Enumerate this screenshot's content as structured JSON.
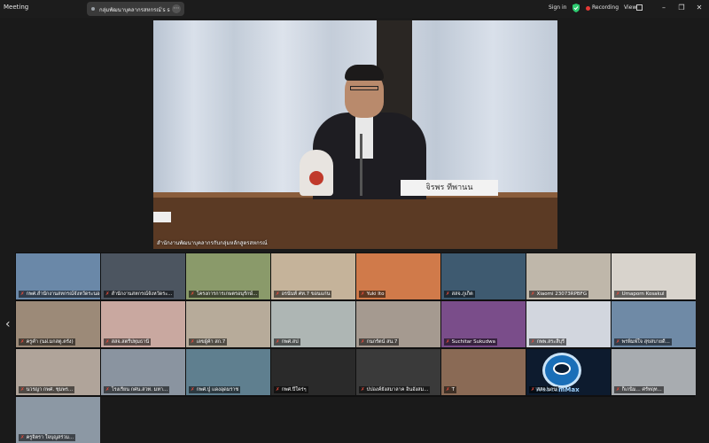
{
  "window": {
    "title": "Meeting",
    "share_text": "กลุ่มพัฒนาบุคลากรสหกรณ์'s screen"
  },
  "topbar": {
    "sign_in": "Sign in",
    "recording": "Recording",
    "view": "View"
  },
  "speaker": {
    "name": "สำนักงานพัฒนาบุคลากรกับกลุ่มหลักสูตรสหกรณ์",
    "nameplate": "จิรพร ทีพานน"
  },
  "colors": {
    "recording": "#e53935",
    "mute": "#e74c3c",
    "shield": "#2ecc71"
  },
  "gallery": [
    {
      "name": "กพศ.สำนักงานสหกรณ์จังหวัดระนอง",
      "muted": true,
      "bg": "#6a88a8"
    },
    {
      "name": "สำนักงานสหกรณ์จังหวัดระ...",
      "muted": true,
      "bg": "#4c5560"
    },
    {
      "name": "โครงการการเกษตรอนุรักษ์...",
      "muted": true,
      "bg": "#8a9a6a"
    },
    {
      "name": "อรนันท์ ศท.7 ขอนแก่น",
      "muted": true,
      "bg": "#c5b39a"
    },
    {
      "name": "Yuki Ito",
      "muted": true,
      "bg": "#d07a4a"
    },
    {
      "name": "สสจ.ภูเก็ต",
      "muted": true,
      "bg": "#3e5a70"
    },
    {
      "name": "Xiaomi 23073RPBFG",
      "muted": true,
      "bg": "#bfb7aa"
    },
    {
      "name": "Umaporn Kosakul",
      "muted": true,
      "bg": "#d8d3cc"
    },
    {
      "name": "ครูคำ (นฝ.มกสตู.ตรัง)",
      "muted": true,
      "bg": "#9c8a78"
    },
    {
      "name": "สสจ.สตรีปทุมธานี",
      "muted": true,
      "bg": "#c9a8a0"
    },
    {
      "name": "เลขผู้ค้า สก.7",
      "muted": true,
      "bg": "#b7ab9a"
    },
    {
      "name": "กพศ.สป",
      "muted": true,
      "bg": "#aeb6b4"
    },
    {
      "name": "กนกรัตน์ สน.7",
      "muted": true,
      "bg": "#a59a90"
    },
    {
      "name": "Suchitar Sukudwa",
      "muted": true,
      "bg": "#7a4d8a"
    },
    {
      "name": "กพพ.สระสีบุรี",
      "muted": true,
      "bg": "#d2d6de"
    },
    {
      "name": "พรพิมพ์ใจ สุขสบายดี...",
      "muted": true,
      "bg": "#6f8aa6"
    },
    {
      "name": "นวรญา กพศ. ชุมพร...",
      "muted": true,
      "bg": "#b0a49a"
    },
    {
      "name": "โรงเรียน กศน.สวท. มหา...",
      "muted": true,
      "bg": "#8a94a0"
    },
    {
      "name": "กพศ.ปู่ แดงอุดมราช",
      "muted": true,
      "bg": "#5f7f8f"
    },
    {
      "name": "กพศ.ปี่ใคร่ๆ",
      "muted": true,
      "bg": "#2a2a2a"
    },
    {
      "name": "ปปองค์ยังสมาลาค อินอังสม...",
      "muted": true,
      "bg": "#3a3a3a"
    },
    {
      "name": "T",
      "muted": true,
      "bg": "#8a6a55"
    },
    {
      "name": "สสจ.นกน",
      "muted": true,
      "bg": "#0d1b2e",
      "webcam": true
    },
    {
      "name": "ก็เกนิม... ศรัทฤท...",
      "muted": true,
      "bg": "#a8acb0"
    },
    {
      "name": "ครูจิตรา ใจบุญสร่วม...",
      "muted": true,
      "bg": "#8c98a4"
    }
  ],
  "webcam_text": "WebcamMax"
}
